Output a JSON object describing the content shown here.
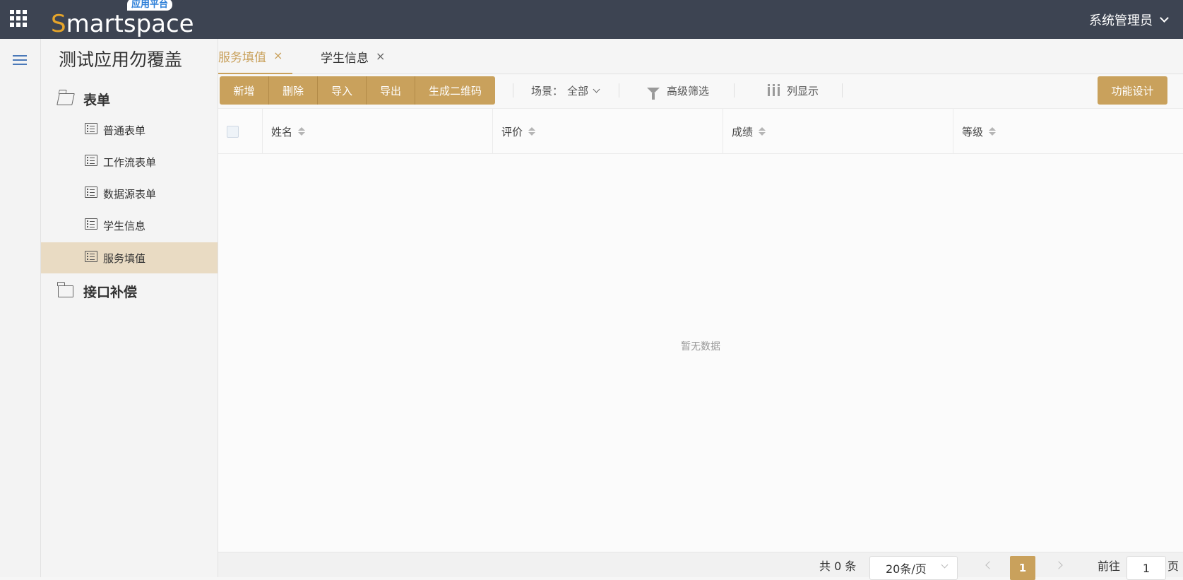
{
  "header": {
    "logo_text_initial": "S",
    "logo_text_rest": "martspace",
    "logo_badge": "应用平台",
    "user_name": "系统管理员"
  },
  "sidebar": {
    "app_title": "测试应用勿覆盖",
    "groups": [
      {
        "label": "表单",
        "items": [
          {
            "label": "普通表单"
          },
          {
            "label": "工作流表单"
          },
          {
            "label": "数据源表单"
          },
          {
            "label": "学生信息"
          },
          {
            "label": "服务填值",
            "active": true
          }
        ]
      },
      {
        "label": "接口补偿",
        "items": []
      }
    ]
  },
  "tabs": [
    {
      "label": "服务填值",
      "active": true
    },
    {
      "label": "学生信息",
      "active": false
    }
  ],
  "tab_close_glyph": "×",
  "toolbar": {
    "buttons": [
      "新增",
      "删除",
      "导入",
      "导出",
      "生成二维码"
    ],
    "scene_label": "场景：",
    "scene_value": "全部",
    "filter_label": "高级筛选",
    "columns_label": "列显示",
    "design_label": "功能设计"
  },
  "table": {
    "columns": [
      "姓名",
      "评价",
      "成绩",
      "等级"
    ],
    "rows": [],
    "empty_text": "暂无数据"
  },
  "pagination": {
    "total_text": "共 0 条",
    "page_size": "20条/页",
    "current_page": "1",
    "goto_label": "前往",
    "goto_value": "1",
    "page_suffix": "页"
  },
  "colors": {
    "topbar": "#3d4452",
    "accent": "#c9a15c",
    "active_menu_bg": "#e9dbc3",
    "logo_orange": "#e6a52a",
    "logo_badge_blue": "#2d7fd8"
  }
}
